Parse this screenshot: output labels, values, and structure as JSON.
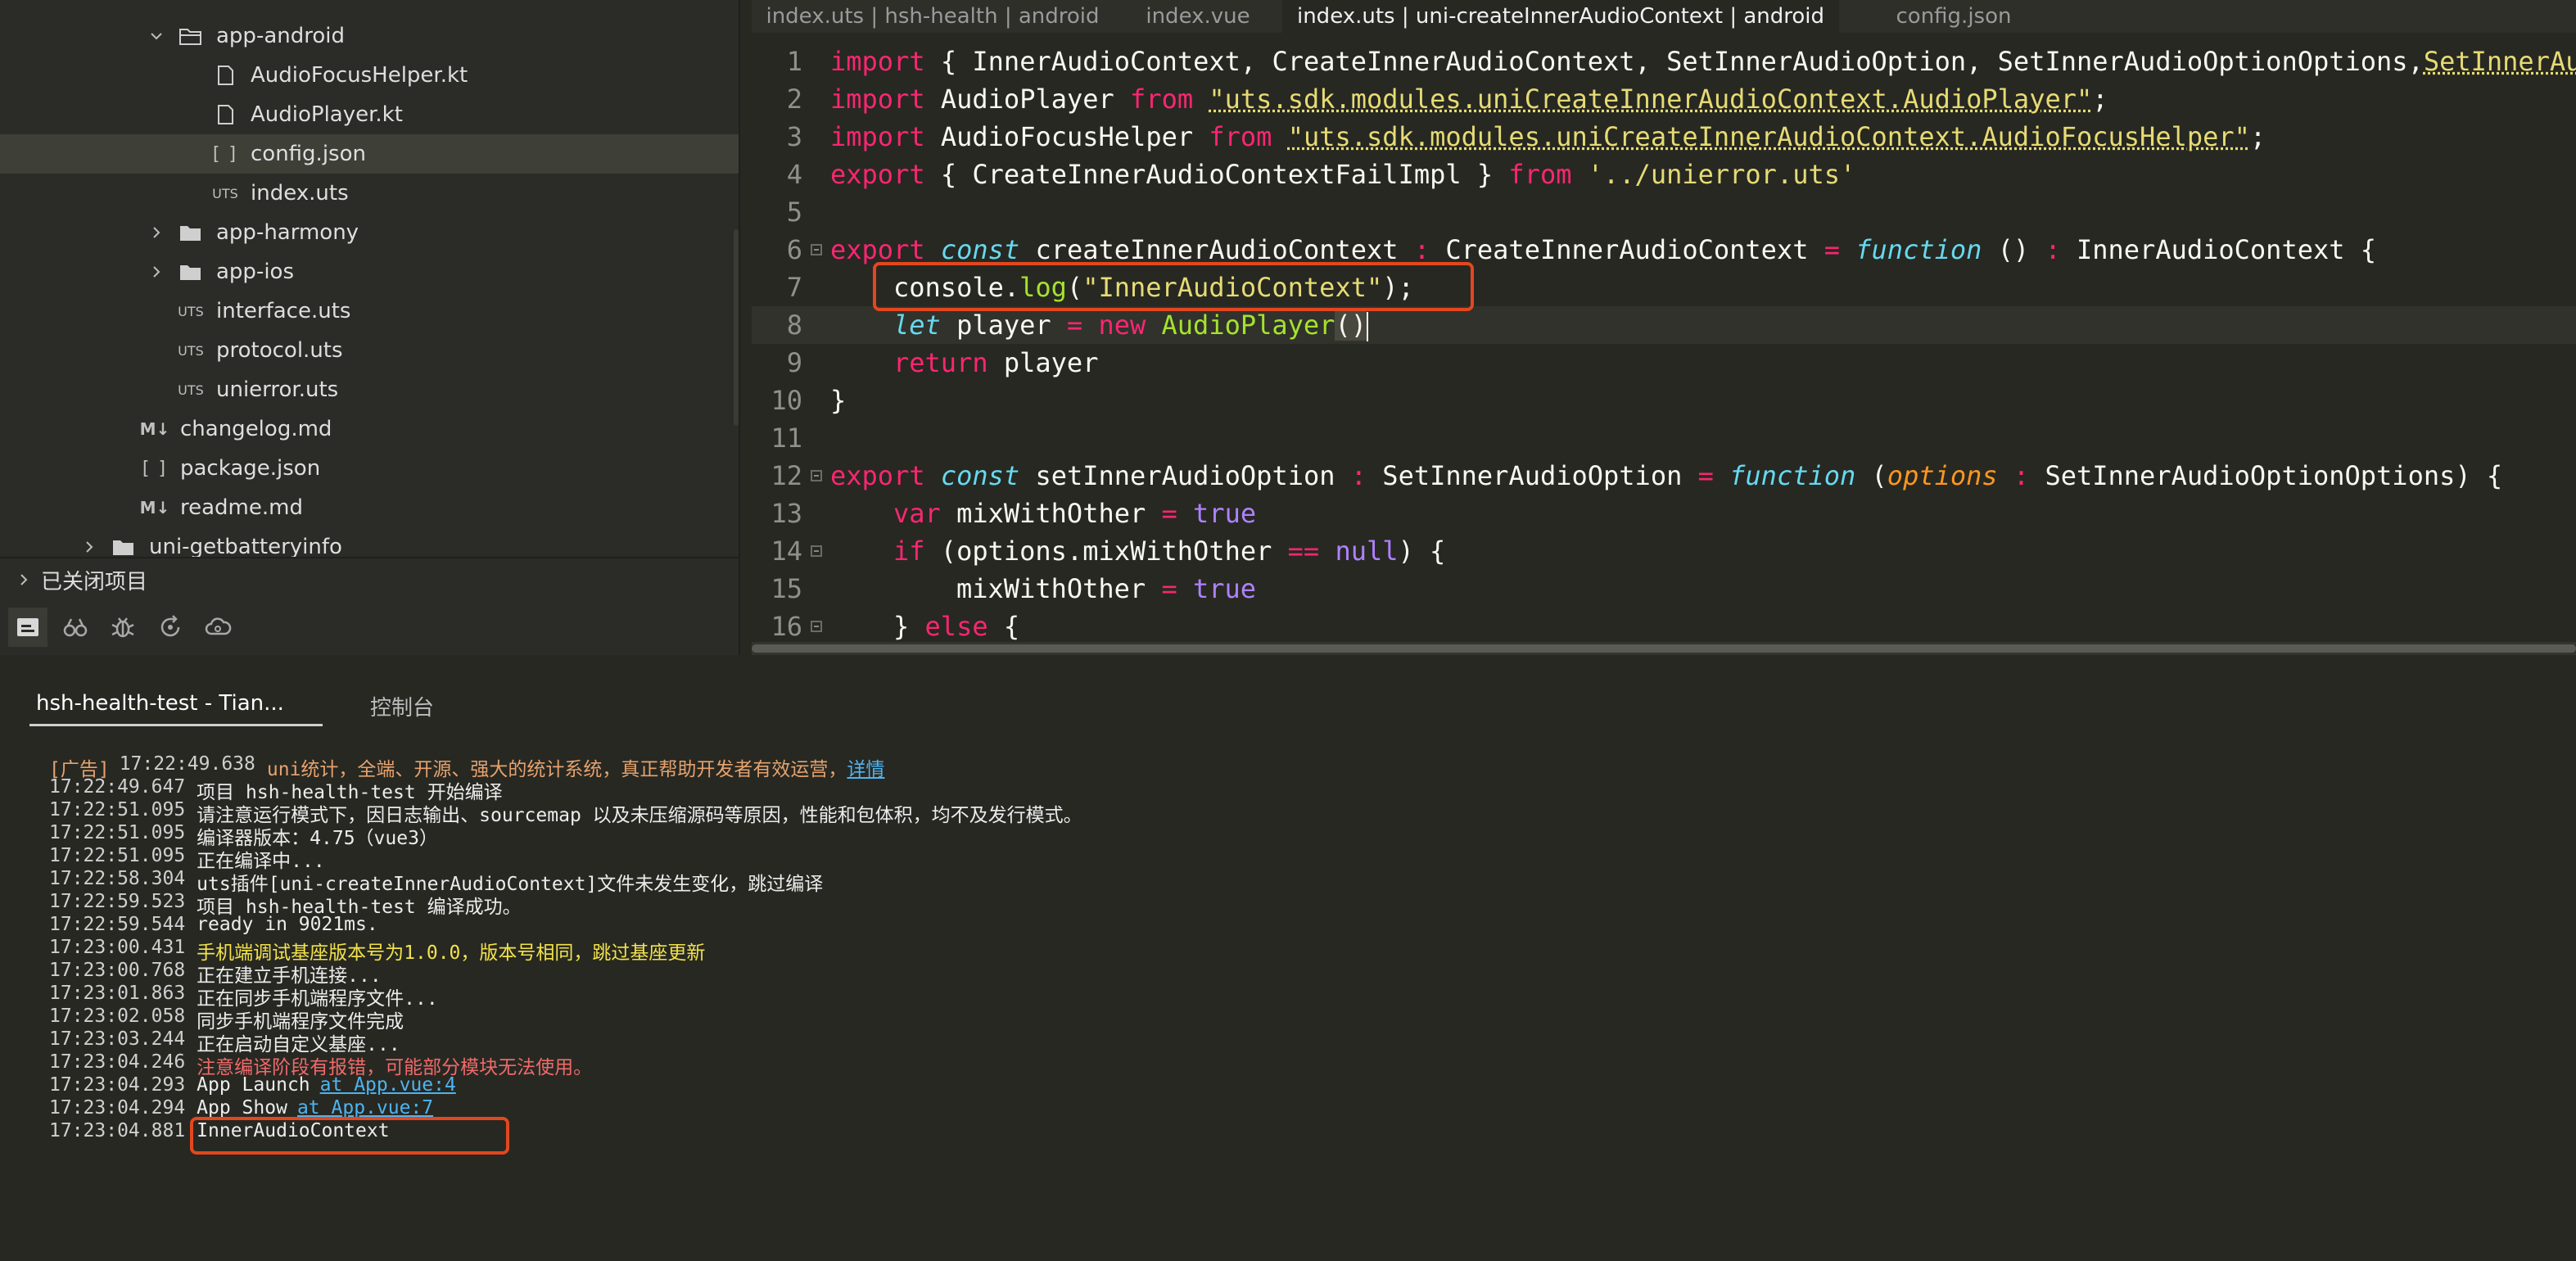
{
  "sidebar": {
    "tree": [
      {
        "label": "app-android",
        "type": "folder",
        "expanded": true
      },
      {
        "label": "AudioFocusHelper.kt",
        "type": "file"
      },
      {
        "label": "AudioPlayer.kt",
        "type": "file"
      },
      {
        "label": "config.json",
        "type": "json",
        "badge": "[ ]"
      },
      {
        "label": "index.uts",
        "type": "uts",
        "badge": "UTS"
      },
      {
        "label": "app-harmony",
        "type": "folder",
        "expanded": false
      },
      {
        "label": "app-ios",
        "type": "folder",
        "expanded": false
      },
      {
        "label": "interface.uts",
        "type": "uts",
        "badge": "UTS"
      },
      {
        "label": "protocol.uts",
        "type": "uts",
        "badge": "UTS"
      },
      {
        "label": "unierror.uts",
        "type": "uts",
        "badge": "UTS"
      },
      {
        "label": "changelog.md",
        "type": "md",
        "badge": "M↓"
      },
      {
        "label": "package.json",
        "type": "json",
        "badge": "[ ]"
      },
      {
        "label": "readme.md",
        "type": "md",
        "badge": "M↓"
      },
      {
        "label": "uni-getbatteryinfo",
        "type": "folder",
        "expanded": false
      }
    ],
    "closed_projects": "已关闭项目",
    "toolbar_icons": [
      "project-manager-icon",
      "binoculars-icon",
      "bug-icon",
      "refresh-icon",
      "cloud-icon"
    ]
  },
  "editor": {
    "tabs": [
      {
        "label": "index.uts | hsh-health | android"
      },
      {
        "label": "index.vue"
      },
      {
        "label": "index.uts | uni-createInnerAudioContext | android"
      },
      {
        "label": "config.json"
      }
    ],
    "active_tab_index": 2,
    "current_line": 8,
    "line_numbers": [
      "1",
      "2",
      "3",
      "4",
      "5",
      "6",
      "7",
      "8",
      "9",
      "10",
      "11",
      "12",
      "13",
      "14",
      "15",
      "16"
    ]
  },
  "console": {
    "tabs": [
      {
        "label": "hsh-health-test - Tian..."
      },
      {
        "label": "控制台"
      }
    ],
    "lines": [
      {
        "prefix": "[广告]",
        "ts": "17:22:49.638",
        "text": "uni统计，全端、开源、强大的统计系统，真正帮助开发者有效运营，",
        "link": "详情",
        "style": "ad"
      },
      {
        "ts": "17:22:49.647",
        "text": "项目 hsh-health-test 开始编译"
      },
      {
        "ts": "17:22:51.095",
        "text": "请注意运行模式下，因日志输出、sourcemap 以及未压缩源码等原因，性能和包体积，均不及发行模式。"
      },
      {
        "ts": "17:22:51.095",
        "text": "编译器版本：4.75（vue3）"
      },
      {
        "ts": "17:22:51.095",
        "text": "正在编译中..."
      },
      {
        "ts": "17:22:58.304",
        "text": "uts插件[uni-createInnerAudioContext]文件未发生变化，跳过编译"
      },
      {
        "ts": "17:22:59.523",
        "text": "项目 hsh-health-test 编译成功。"
      },
      {
        "ts": "17:22:59.544",
        "text": "ready in 9021ms."
      },
      {
        "ts": "17:23:00.431",
        "text": "手机端调试基座版本号为1.0.0，版本号相同，跳过基座更新",
        "style": "yellow"
      },
      {
        "ts": "17:23:00.768",
        "text": "正在建立手机连接..."
      },
      {
        "ts": "17:23:01.863",
        "text": "正在同步手机端程序文件..."
      },
      {
        "ts": "17:23:02.058",
        "text": "同步手机端程序文件完成"
      },
      {
        "ts": "17:23:03.244",
        "text": "正在启动自定义基座..."
      },
      {
        "ts": "17:23:04.246",
        "text": "注意编译阶段有报错，可能部分模块无法使用。",
        "style": "red"
      },
      {
        "ts": "17:23:04.293",
        "text": "App Launch",
        "link": "at App.vue:4"
      },
      {
        "ts": "17:23:04.294",
        "text": "App Show",
        "link": "at App.vue:7"
      },
      {
        "ts": "17:23:04.881",
        "text": "InnerAudioContext"
      }
    ]
  },
  "colors": {
    "background": "#272822",
    "keyword": "#f92672",
    "storage": "#66d9ef",
    "function": "#a6e22e",
    "string": "#e6db74",
    "constant": "#ae81ff",
    "parameter": "#fd971f",
    "highlight_box": "#e3471f",
    "console_link": "#4fb3f0",
    "console_warning": "#f2e24a",
    "console_error": "#f06a6a"
  }
}
